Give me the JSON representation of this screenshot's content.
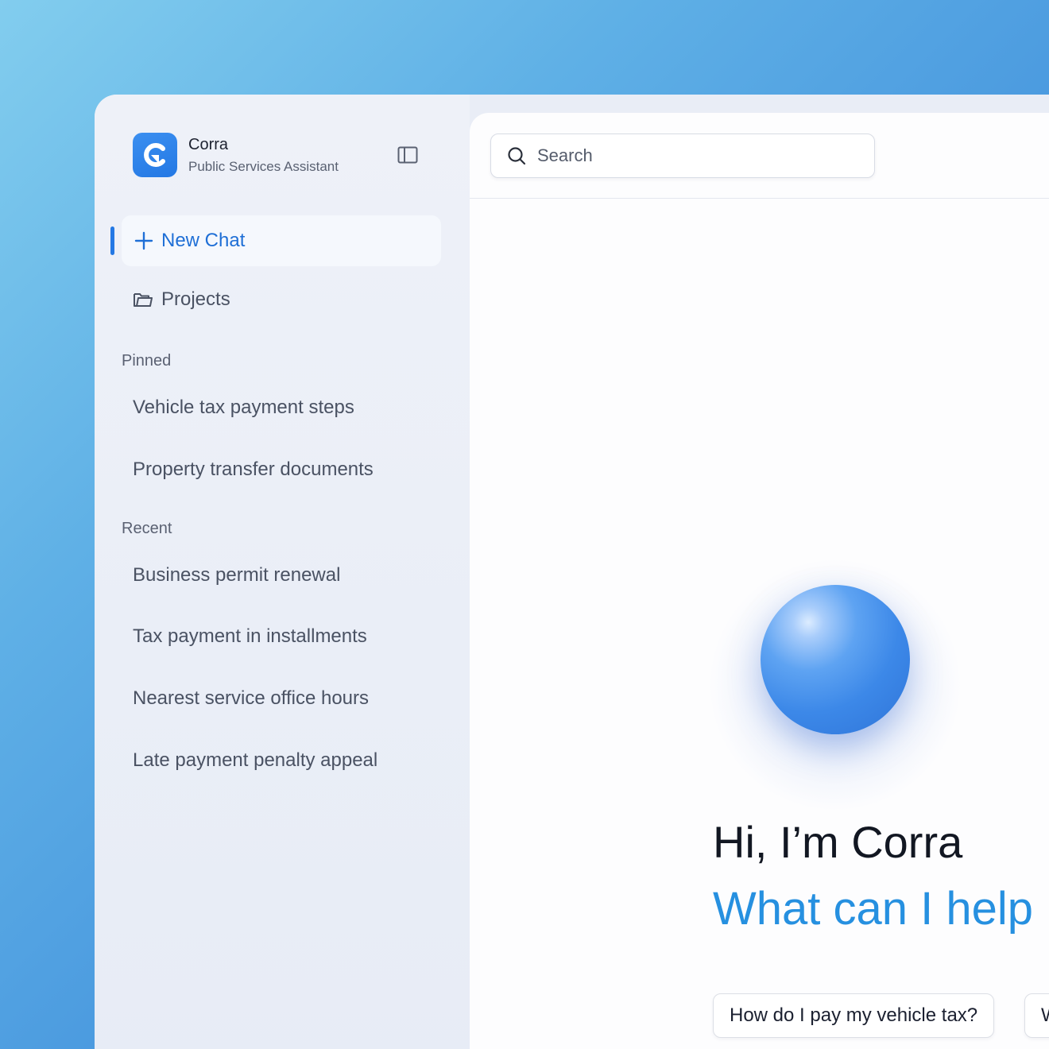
{
  "app": {
    "name": "Corra",
    "subtitle": "Public Services Assistant"
  },
  "sidebar": {
    "new_chat_label": "New Chat",
    "projects_label": "Projects",
    "pinned": {
      "title": "Pinned",
      "items": [
        "Vehicle tax payment steps",
        "Property transfer documents"
      ]
    },
    "recent": {
      "title": "Recent",
      "items": [
        "Business permit renewal",
        "Tax payment in installments",
        "Nearest service office hours",
        "Late payment penalty appeal"
      ]
    }
  },
  "search": {
    "placeholder": "Search",
    "value": ""
  },
  "main": {
    "greeting": "Hi, I’m Corra",
    "prompt": "What can I help",
    "suggestions": [
      "How do I pay my vehicle tax?",
      "W"
    ]
  },
  "colors": {
    "accent": "#2478e4",
    "prompt_text": "#2690e0",
    "background_gradient_start": "#82cdee",
    "background_gradient_end": "#3d8bdb"
  }
}
